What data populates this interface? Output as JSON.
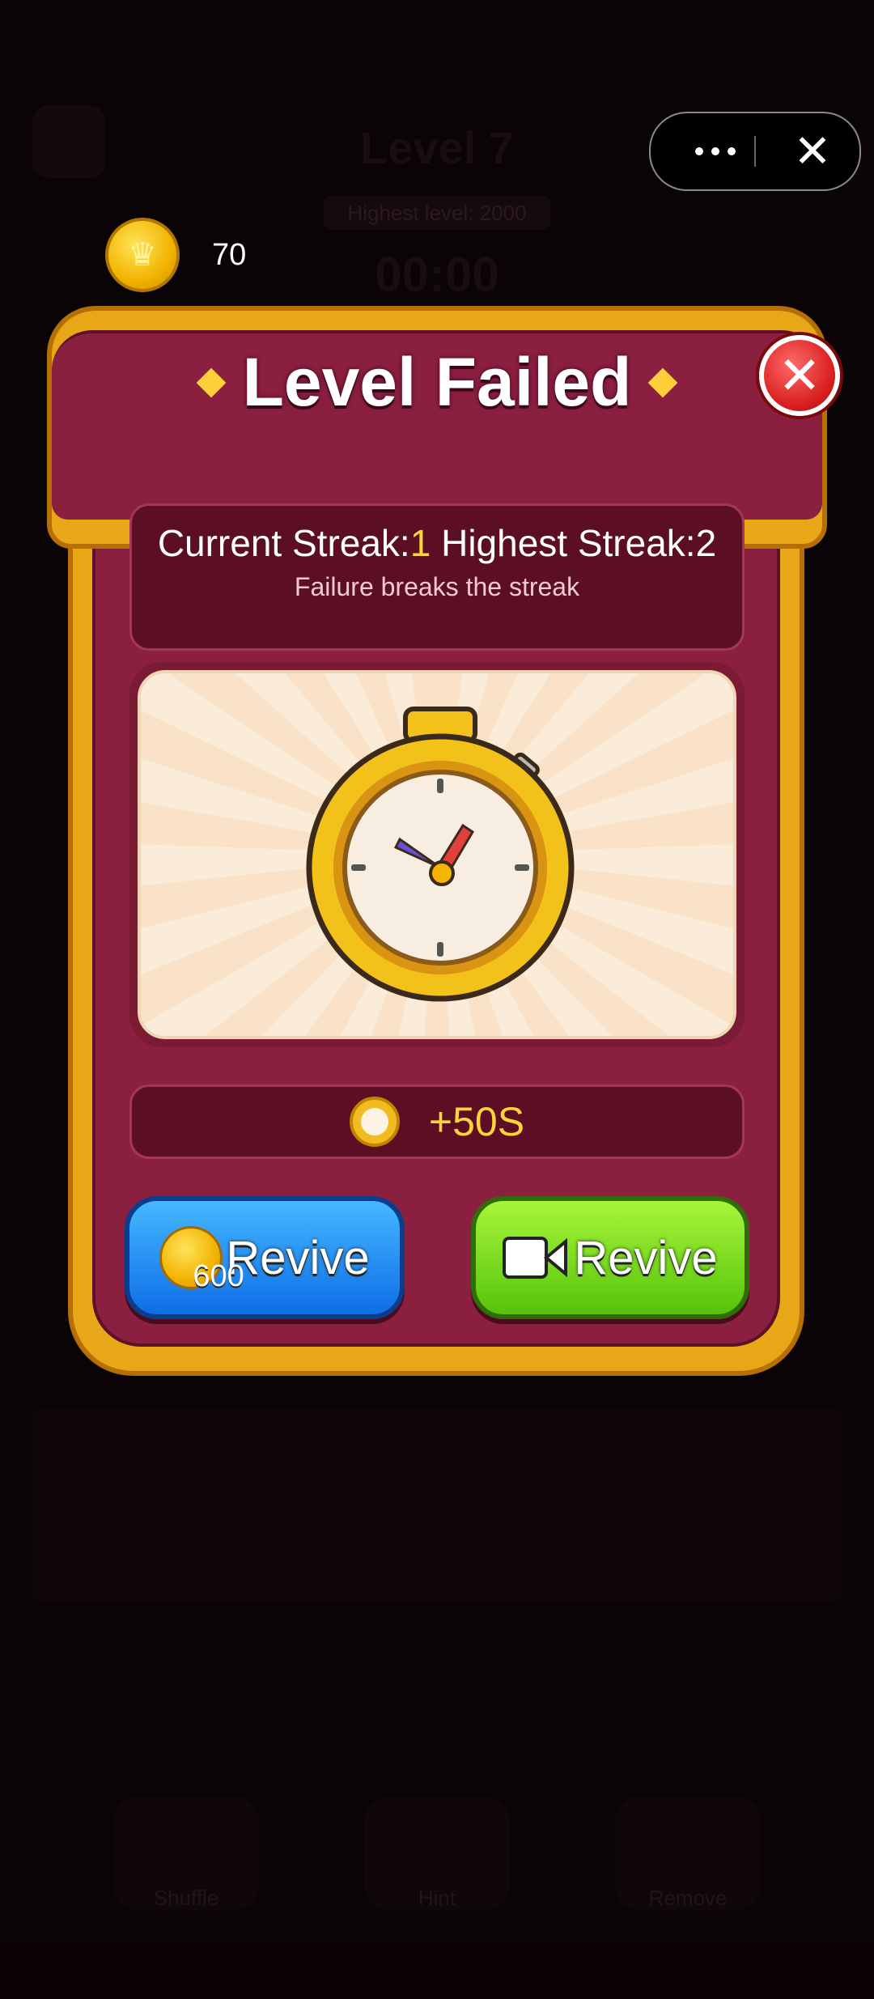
{
  "background": {
    "level_title": "Level 7",
    "hint_text": "Highest level: 2000",
    "timer": "00:00",
    "tools": [
      "Shuffle",
      "Hint",
      "Remove"
    ]
  },
  "capsule": {
    "more_icon": "ellipsis-icon",
    "close_icon": "close-icon"
  },
  "coins": {
    "icon": "crown-coin-icon",
    "value": "70"
  },
  "dialog": {
    "title": "Level Failed",
    "streak_label": "Current Streak:",
    "streak_current": "1",
    "streak_highest_label": " Highest Streak:",
    "streak_highest": "2",
    "streak_note": "Failure breaks the streak",
    "illustration": "stopwatch-illustration",
    "reward_text": "+50S",
    "revive_coin_cost": "600",
    "revive_coin_label": "Revive",
    "revive_video_label": "Revive"
  },
  "colors": {
    "dialog_body": "#8b1f3f",
    "dialog_frame": "#e7a716",
    "accent_yellow": "#ffd43a",
    "button_blue": "#0e6ee6",
    "button_green": "#55c40a"
  }
}
